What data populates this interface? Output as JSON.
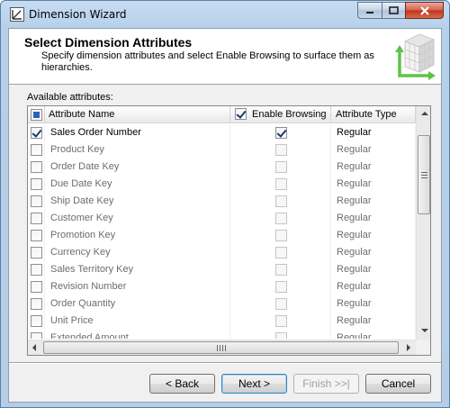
{
  "window": {
    "title": "Dimension Wizard"
  },
  "header": {
    "title": "Select Dimension Attributes",
    "description": "Specify dimension attributes and select Enable Browsing to surface them as hierarchies."
  },
  "grid": {
    "label": "Available attributes:",
    "columns": {
      "name": "Attribute Name",
      "browsing": "Enable Browsing",
      "type": "Attribute Type"
    },
    "rows": [
      {
        "name": "Sales Order Number",
        "checked": true,
        "browsing": true,
        "type": "Regular"
      },
      {
        "name": "Product Key",
        "checked": false,
        "browsing": false,
        "type": "Regular"
      },
      {
        "name": "Order Date Key",
        "checked": false,
        "browsing": false,
        "type": "Regular"
      },
      {
        "name": "Due Date Key",
        "checked": false,
        "browsing": false,
        "type": "Regular"
      },
      {
        "name": "Ship Date Key",
        "checked": false,
        "browsing": false,
        "type": "Regular"
      },
      {
        "name": "Customer Key",
        "checked": false,
        "browsing": false,
        "type": "Regular"
      },
      {
        "name": "Promotion Key",
        "checked": false,
        "browsing": false,
        "type": "Regular"
      },
      {
        "name": "Currency Key",
        "checked": false,
        "browsing": false,
        "type": "Regular"
      },
      {
        "name": "Sales Territory Key",
        "checked": false,
        "browsing": false,
        "type": "Regular"
      },
      {
        "name": "Revision Number",
        "checked": false,
        "browsing": false,
        "type": "Regular"
      },
      {
        "name": "Order Quantity",
        "checked": false,
        "browsing": false,
        "type": "Regular"
      },
      {
        "name": "Unit Price",
        "checked": false,
        "browsing": false,
        "type": "Regular"
      },
      {
        "name": "Extended Amount",
        "checked": false,
        "browsing": false,
        "type": "Regular"
      }
    ]
  },
  "buttons": {
    "back": "< Back",
    "next": "Next >",
    "finish": "Finish >>|",
    "cancel": "Cancel"
  },
  "icons": {
    "app": "dimension-wizard-icon",
    "header": "dimension-cube-icon"
  }
}
